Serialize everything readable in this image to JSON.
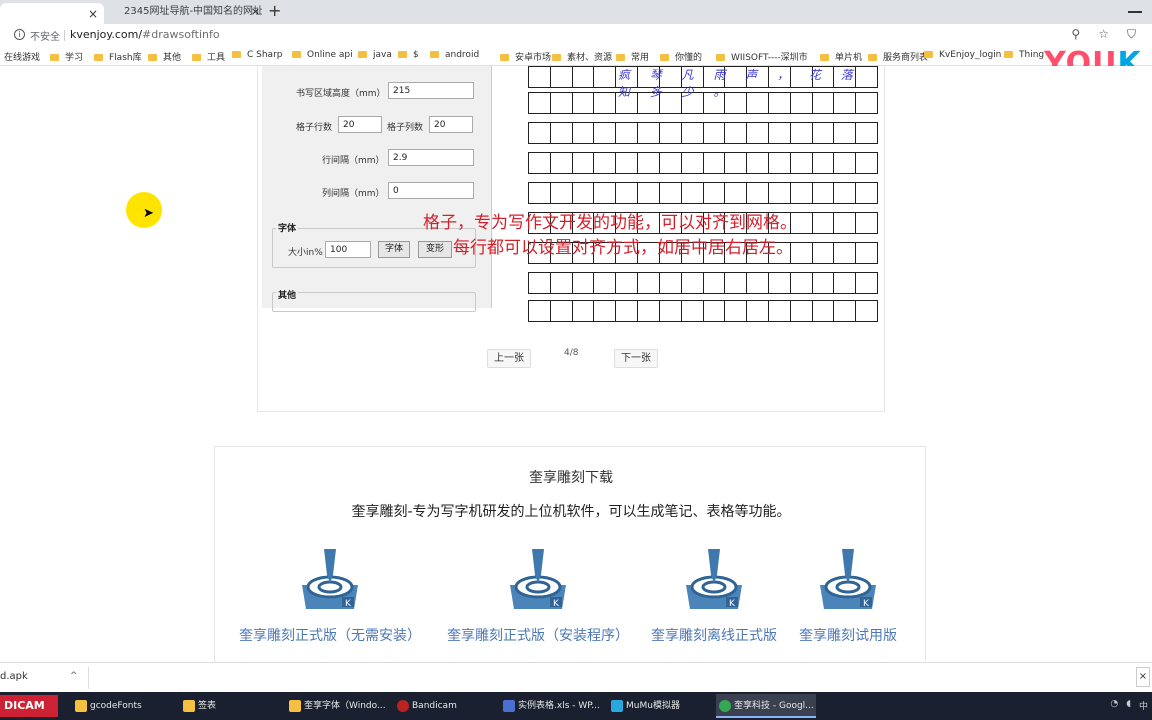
{
  "browser": {
    "tabs": [
      {
        "title": "",
        "close": "×"
      },
      {
        "title": "2345网址导航-中国知名的网址",
        "close": "×"
      }
    ],
    "new_tab": "+",
    "address": {
      "security": "不安全",
      "url_host": "kvenjoy.com/",
      "url_fragment": "#drawsoftinfo"
    },
    "bookmarks": [
      "在线游戏",
      "学习",
      "Flash库",
      "其他",
      "工具",
      "C Sharp",
      "Online api",
      "java",
      "$",
      "android",
      "安卓市场",
      "素材、资源",
      "常用",
      "你懂的",
      "WIISOFT----深圳市",
      "单片机",
      "服务商列表",
      "KvEnjoy_login",
      "Thing"
    ]
  },
  "watermark": {
    "you": "YOU",
    "k": "K"
  },
  "app_form": {
    "area_height_label": "书写区域高度（mm）",
    "area_height_value": "215",
    "rows_label": "格子行数",
    "rows_value": "20",
    "cols_label": "格子列数",
    "cols_value": "20",
    "row_gap_label": "行间隔（mm）",
    "row_gap_value": "2.9",
    "col_gap_label": "列间隔（mm）",
    "col_gap_value": "0",
    "font_group": "字体",
    "size_label": "大小in%",
    "size_value": "100",
    "font_button": "字体",
    "transform_button": "变形",
    "other_group": "其他"
  },
  "handwriting": "疯 琴 凡 雨 声 ， 花 落 知 多 少 。",
  "overlay": {
    "line1": "格子，专为写作文开发的功能，可以对齐到网格。",
    "line2": "每行都可以设置对齐方式，如居中居右居左。"
  },
  "pager": {
    "prev": "上一张",
    "next": "下一张",
    "count": "4/8"
  },
  "download": {
    "title": "奎享雕刻下载",
    "description": "奎享雕刻-专为写字机研发的上位机软件，可以生成笔记、表格等功能。",
    "items": [
      {
        "label": "奎享雕刻正式版（无需安装）",
        "icon": "engraver-icon"
      },
      {
        "label": "奎享雕刻正式版（安装程序）",
        "icon": "engraver-icon"
      },
      {
        "label": "奎享雕刻离线正式版",
        "icon": "engraver-icon"
      },
      {
        "label": "奎享雕刻试用版",
        "icon": "engraver-icon"
      }
    ]
  },
  "downloads_bar": {
    "file": "d.apk",
    "caret": "^",
    "close": "×"
  },
  "taskbar": {
    "start": "DICAM",
    "items": [
      "gcodeFonts",
      "签表",
      "奎享字体（Windo...",
      "Bandicam",
      "实例表格.xls - WP...",
      "MuMu模拟器",
      "奎享科技 - Googl..."
    ],
    "tray": "中"
  },
  "colors": {
    "accent_link": "#4d78b7",
    "overlay_red": "#d31f2a",
    "handwriting_blue": "#3a3ad0"
  }
}
